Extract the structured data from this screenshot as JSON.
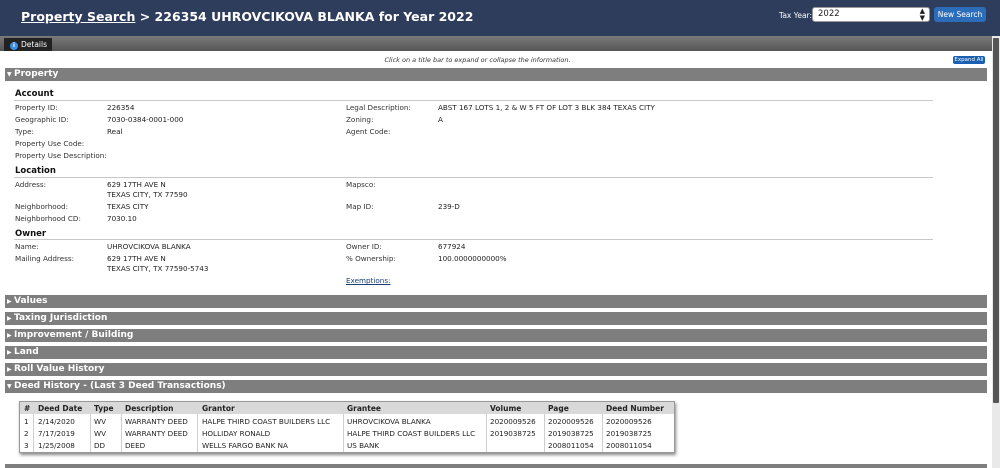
{
  "header": {
    "title_link": "Property Search",
    "title_rest": " > 226354 UHROVCIKOVA BLANKA for Year 2022",
    "tax_year_label": "Tax Year:",
    "tax_year_value": "2022",
    "new_search": "New Search"
  },
  "tabs": {
    "details": "Details"
  },
  "hint": "Click on a title bar to expand or collapse the information.",
  "expand_all": "Expand All",
  "property": {
    "section_title": "Property",
    "account": {
      "heading": "Account",
      "property_id_label": "Property ID:",
      "property_id": "226354",
      "geographic_id_label": "Geographic ID:",
      "geographic_id": "7030-0384-0001-000",
      "type_label": "Type:",
      "type": "Real",
      "use_code_label": "Property Use Code:",
      "use_desc_label": "Property Use Description:",
      "legal_label": "Legal Description:",
      "legal": "ABST 167 LOTS 1, 2 & W 5 FT OF LOT 3 BLK 384 TEXAS CITY",
      "zoning_label": "Zoning:",
      "zoning": "A",
      "agent_label": "Agent Code:"
    },
    "location": {
      "heading": "Location",
      "address_label": "Address:",
      "address_line1": "629 17TH AVE N",
      "address_line2": "TEXAS CITY, TX 77590",
      "neighborhood_label": "Neighborhood:",
      "neighborhood": "TEXAS CITY",
      "neighborhood_cd_label": "Neighborhood CD:",
      "neighborhood_cd": "7030.10",
      "mapsco_label": "Mapsco:",
      "map_id_label": "Map ID:",
      "map_id": "239-D"
    },
    "owner": {
      "heading": "Owner",
      "name_label": "Name:",
      "name": "UHROVCIKOVA BLANKA",
      "mailing_label": "Mailing Address:",
      "mailing_line1": "629 17TH AVE N",
      "mailing_line2": "TEXAS CITY, TX 77590-5743",
      "owner_id_label": "Owner ID:",
      "owner_id": "677924",
      "ownership_label": "% Ownership:",
      "ownership": "100.0000000000%",
      "exemptions": "Exemptions:"
    }
  },
  "sections": {
    "values": "Values",
    "taxing": "Taxing Jurisdiction",
    "improvement": "Improvement / Building",
    "land": "Land",
    "roll_value": "Roll Value History",
    "deed_history": "Deed History - (Last 3 Deed Transactions)"
  },
  "deed_table": {
    "headers": [
      "#",
      "Deed Date",
      "Type",
      "Description",
      "Grantor",
      "Grantee",
      "Volume",
      "Page",
      "Deed Number"
    ],
    "rows": [
      [
        "1",
        "2/14/2020",
        "WV",
        "WARRANTY DEED",
        "HALPE THIRD COAST BUILDERS LLC",
        "UHROVCIKOVA BLANKA",
        "2020009526",
        "2020009526",
        "2020009526"
      ],
      [
        "2",
        "7/17/2019",
        "WV",
        "WARRANTY DEED",
        "HOLLIDAY RONALD",
        "HALPE THIRD COAST BUILDERS LLC",
        "2019038725",
        "2019038725",
        "2019038725"
      ],
      [
        "3",
        "1/25/2008",
        "DD",
        "DEED",
        "WELLS FARGO BANK NA",
        "US BANK",
        "",
        "2008011054",
        "2008011054"
      ]
    ]
  }
}
